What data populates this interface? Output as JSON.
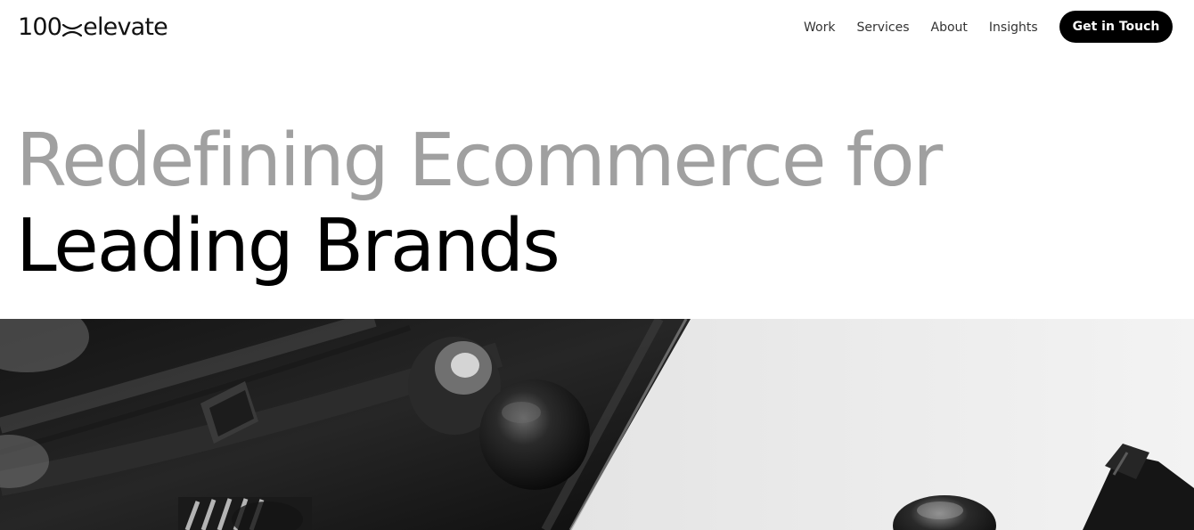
{
  "header": {
    "logo": {
      "prefix": "100",
      "suffix": "elevate"
    },
    "nav": [
      {
        "label": "Work"
      },
      {
        "label": "Services"
      },
      {
        "label": "About"
      },
      {
        "label": "Insights"
      }
    ],
    "cta_label": "Get in Touch"
  },
  "hero": {
    "title_line1": "Redefining Ecommerce for",
    "title_line2": "Leading Brands",
    "image": {
      "subject": "watch-closeup-photo",
      "tone": "grayscale"
    }
  },
  "colors": {
    "background": "#ffffff",
    "text_primary": "#000000",
    "text_muted": "#a0a0a0",
    "nav_text": "#333333",
    "button_bg": "#000000",
    "button_text": "#ffffff"
  }
}
